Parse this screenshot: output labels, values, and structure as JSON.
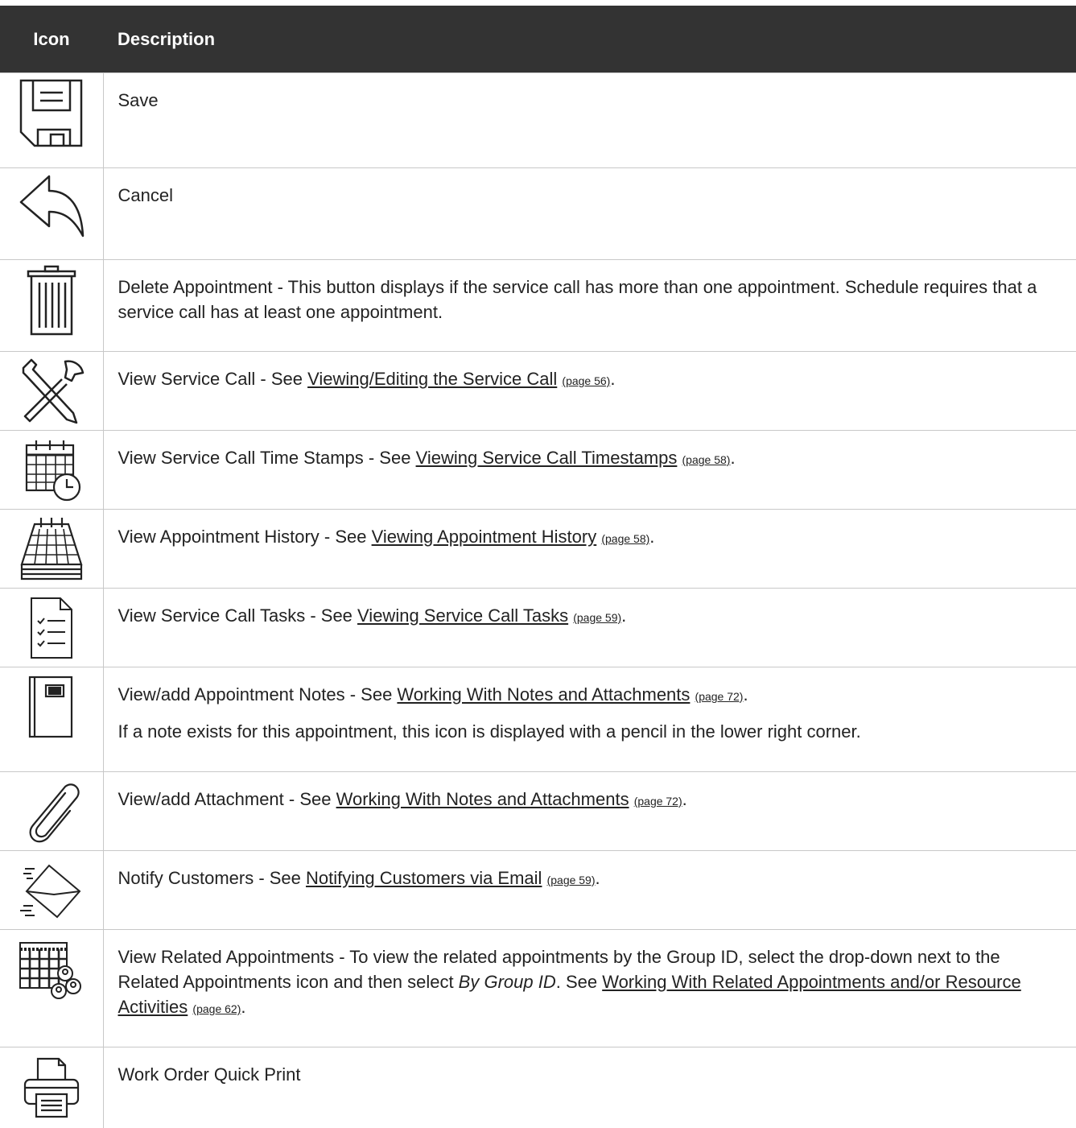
{
  "table": {
    "headers": {
      "icon": "Icon",
      "description": "Description"
    },
    "rows": [
      {
        "icon": "save-icon",
        "text": "Save"
      },
      {
        "icon": "cancel-icon",
        "text": "Cancel"
      },
      {
        "icon": "delete-icon",
        "text": "Delete Appointment - This button displays if the service call has more than one appointment. Schedule requires that a service call has at least one appointment."
      },
      {
        "icon": "tools-icon",
        "prefix": "View Service Call - See ",
        "link": "Viewing/Editing the Service Call",
        "page": "(page 56)",
        "suffix": "."
      },
      {
        "icon": "calendar-clock-icon",
        "prefix": "View Service Call Time Stamps - See ",
        "link": "Viewing Service Call Timestamps",
        "page": "(page 58)",
        "suffix": "."
      },
      {
        "icon": "appointment-history-icon",
        "prefix": "View Appointment History - See ",
        "link": "Viewing Appointment History",
        "page": "(page 58)",
        "suffix": "."
      },
      {
        "icon": "task-list-icon",
        "prefix": "View Service Call Tasks - See ",
        "link": "Viewing Service Call Tasks",
        "page": "(page 59)",
        "suffix": "."
      },
      {
        "icon": "notebook-icon",
        "prefix": "View/add Appointment Notes - See ",
        "link": "Working With Notes and Attachments",
        "page": "(page 72)",
        "suffix": ".",
        "extra": "If a note exists for this appointment, this icon is displayed with a pencil in the lower right corner."
      },
      {
        "icon": "paperclip-icon",
        "prefix": "View/add Attachment - See ",
        "link": "Working With Notes and Attachments",
        "page": "(page 72)",
        "suffix": "."
      },
      {
        "icon": "envelope-icon",
        "prefix": "Notify Customers - See ",
        "link": "Notifying Customers via Email",
        "page": "(page 59)",
        "suffix": "."
      },
      {
        "icon": "related-appointments-icon",
        "prefix": "View Related Appointments - To view the related appointments by the Group ID, select the drop-down next to the Related Appointments icon and then select ",
        "italic": "By Group ID",
        "mid": ". See ",
        "link": "Working With Related Appointments and/or Resource Activities",
        "page": "(page 62)",
        "suffix": "."
      },
      {
        "icon": "printer-icon",
        "text": "Work Order Quick Print"
      }
    ]
  }
}
